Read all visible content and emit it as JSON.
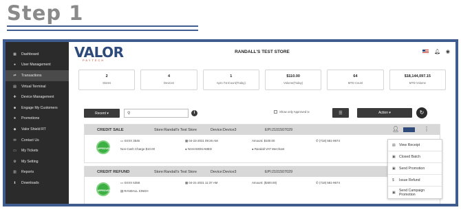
{
  "step": {
    "title": "Step 1"
  },
  "sidebar": {
    "items": [
      {
        "icon": "dashboard-icon",
        "glyph": "▦",
        "label": "Dashboard"
      },
      {
        "icon": "user-icon",
        "glyph": "●",
        "label": "User Management"
      },
      {
        "icon": "transactions-icon",
        "glyph": "⇄",
        "label": "Transactions",
        "active": true
      },
      {
        "icon": "terminal-icon",
        "glyph": "▤",
        "label": "Virtual Terminal"
      },
      {
        "icon": "device-icon",
        "glyph": "✚",
        "label": "Device Management"
      },
      {
        "icon": "customers-icon",
        "glyph": "☻",
        "label": "Engage My Customers"
      },
      {
        "icon": "promotions-icon",
        "glyph": "★",
        "label": "Promotions"
      },
      {
        "icon": "shield-icon",
        "glyph": "◆",
        "label": "Valor Shield RT"
      },
      {
        "icon": "contact-icon",
        "glyph": "✉",
        "label": "Contact Us"
      },
      {
        "icon": "ticket-icon",
        "glyph": "▭",
        "label": "My Tickets"
      },
      {
        "icon": "settings-icon",
        "glyph": "⚙",
        "label": "My Setting"
      },
      {
        "icon": "reports-icon",
        "glyph": "▥",
        "label": "Reports"
      },
      {
        "icon": "download-icon",
        "glyph": "⬇",
        "label": "Downloads"
      }
    ]
  },
  "header": {
    "logo": "VALOR",
    "logo_sub": "PAYTECH",
    "store_title": "RANDALL'S TEST STORE"
  },
  "stats": [
    {
      "value": "2",
      "label": "Stores"
    },
    {
      "value": "4",
      "label": "Devices"
    },
    {
      "value": "1",
      "label": "Apro.TxnCount(Today)"
    },
    {
      "value": "$110.00",
      "label": "Volume(Today)"
    },
    {
      "value": "64",
      "label": "MTD Count"
    },
    {
      "value": "$18,144,097.15",
      "label": "MTD Volume"
    }
  ],
  "toolbar": {
    "recent_label": "Recent ▾",
    "search_placeholder": "",
    "approved_label": "Show only Approved tx",
    "action_label": "Action ▾"
  },
  "transactions": [
    {
      "type": "CREDIT SALE",
      "store": "Store:Randall's Test Store",
      "device": "Device:Device3",
      "epi": "EPI:2101507029",
      "card": "XXXX 3546",
      "charge": "Non-Cash Charge $10.00",
      "date": "04-23-2021 09:26 AM",
      "user": "NAHAMOHAMED",
      "amount": "Amount: $100.00",
      "merchant": "Randall VAT Merchant",
      "phone": "(718) 581-9674",
      "stamp": "APPROVED"
    },
    {
      "type": "CREDIT REFUND",
      "store": "Store:Randall's Test Store",
      "device": "Device:Device3",
      "epi": "EPI:2101507029",
      "card": "XXXX 6358",
      "charge": "RANDALL SINGH",
      "date": "04-21-2021 11:37 AM",
      "amount": "Amount: ($400.00)",
      "phone": "(718) 581-9674",
      "stamp": "APPROVED"
    }
  ],
  "context_menu": [
    {
      "icon": "receipt-icon",
      "glyph": "▤",
      "label": "View Receipt"
    },
    {
      "icon": "batch-icon",
      "glyph": "▣",
      "label": "Closed Batch"
    },
    {
      "icon": "promotion-icon",
      "glyph": "▣",
      "label": "Send Promotion"
    },
    {
      "icon": "refund-icon",
      "glyph": "$",
      "label": "Issue Refund"
    },
    {
      "icon": "campaign-icon",
      "glyph": "▣",
      "label": "Send Campaign Promotion"
    }
  ]
}
